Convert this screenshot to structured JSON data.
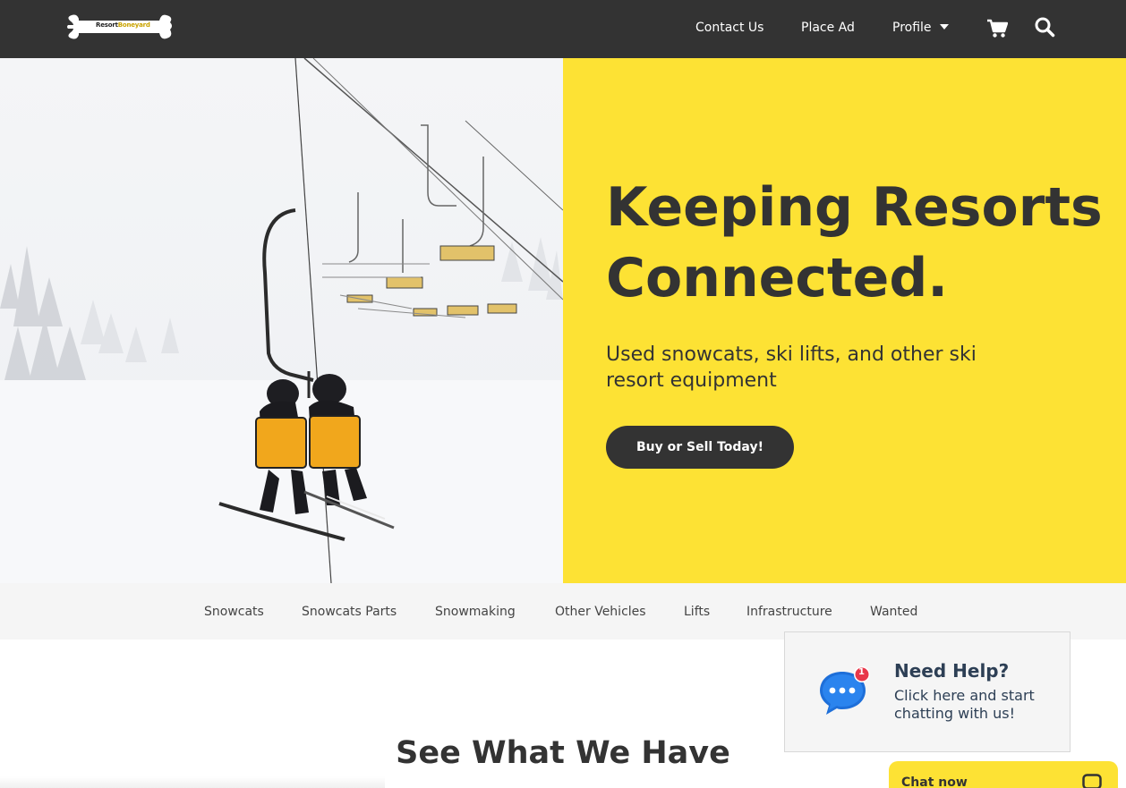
{
  "header": {
    "logo_alt": "ResortBoneyard logo",
    "logo_text_a": "Resort",
    "logo_text_b": "Boneyard",
    "nav": {
      "contact": "Contact Us",
      "place_ad": "Place Ad",
      "profile": "Profile"
    },
    "icons": [
      "cart-icon",
      "search-icon",
      "chevron-down-icon"
    ]
  },
  "hero": {
    "title_line1": "Keeping Resorts",
    "title_line2": "Connected.",
    "subtitle": "Used snowcats, ski lifts, and other ski resort equipment",
    "cta": "Buy or Sell Today!",
    "image_alt": "Skiers on a chairlift in snow"
  },
  "categories": [
    "Snowcats",
    "Snowcats Parts",
    "Snowmaking",
    "Other Vehicles",
    "Lifts",
    "Infrastructure",
    "Wanted"
  ],
  "section": {
    "title": "See What We Have"
  },
  "chat": {
    "help_title": "Need Help?",
    "help_text": "Click here and start chatting with us!",
    "badge_count": "1",
    "chat_now": "Chat now"
  },
  "colors": {
    "header_bg": "#333333",
    "accent_yellow": "#fde234",
    "text_dark": "#333333",
    "chat_blue": "#1e6fd9",
    "badge_red": "#e8374a"
  }
}
